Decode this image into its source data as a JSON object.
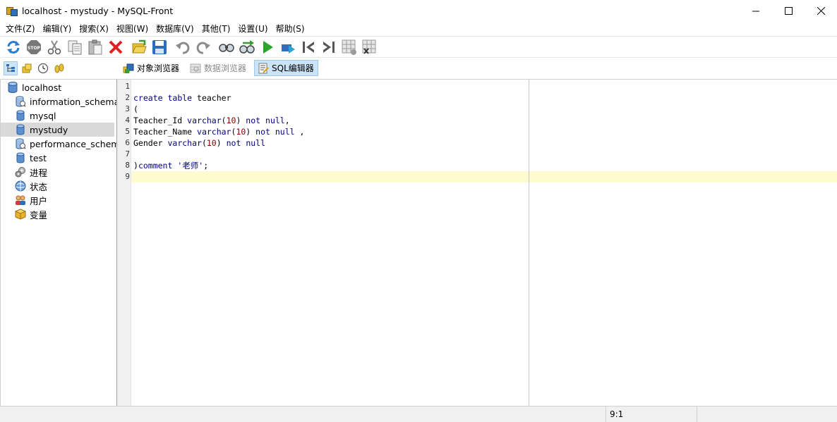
{
  "window": {
    "title": "localhost - mystudy - MySQL-Front",
    "controls": {
      "minimize": "—",
      "maximize": "☐",
      "close": "✕"
    }
  },
  "menu": [
    "文件(Z)",
    "编辑(Y)",
    "搜索(X)",
    "视图(W)",
    "数据库(V)",
    "其他(T)",
    "设置(U)",
    "帮助(S)"
  ],
  "toolbar": {
    "icons": [
      "refresh-icon",
      "stop-icon",
      "cut-icon",
      "copy-icon",
      "paste-icon",
      "delete-icon",
      "open-icon",
      "save-icon",
      "undo-icon",
      "redo-icon",
      "find-icon",
      "replace-icon",
      "run-icon",
      "run-selection-icon",
      "first-icon",
      "last-icon",
      "grid-add-icon",
      "grid-delete-icon"
    ]
  },
  "view_tabs": {
    "object_browser": "对象浏览器",
    "data_browser": "数据浏览器",
    "sql_editor": "SQL编辑器"
  },
  "tree": {
    "root": "localhost",
    "items": [
      {
        "label": "information_schema",
        "icon": "system-db-icon"
      },
      {
        "label": "mysql",
        "icon": "database-icon"
      },
      {
        "label": "mystudy",
        "icon": "database-icon",
        "selected": true
      },
      {
        "label": "performance_schema",
        "icon": "system-db-icon"
      },
      {
        "label": "test",
        "icon": "database-icon"
      },
      {
        "label": "进程",
        "icon": "process-icon"
      },
      {
        "label": "状态",
        "icon": "status-icon"
      },
      {
        "label": "用户",
        "icon": "users-icon"
      },
      {
        "label": "变量",
        "icon": "variables-icon"
      }
    ]
  },
  "editor": {
    "line_numbers": [
      "1",
      "2",
      "3",
      "4",
      "5",
      "6",
      "7",
      "8",
      "9"
    ],
    "lines": [
      "",
      "create table teacher",
      "(",
      "Teacher_Id varchar(10) not null,",
      "Teacher_Name varchar(10) not null ,",
      "Gender varchar(10) not null",
      "",
      ")comment '老师';",
      ""
    ]
  },
  "status": {
    "position": "9:1"
  },
  "colors": {
    "keyword": "#000080",
    "number": "#800000",
    "current_line": "#fdfbcf",
    "selection": "#cce4f7"
  }
}
